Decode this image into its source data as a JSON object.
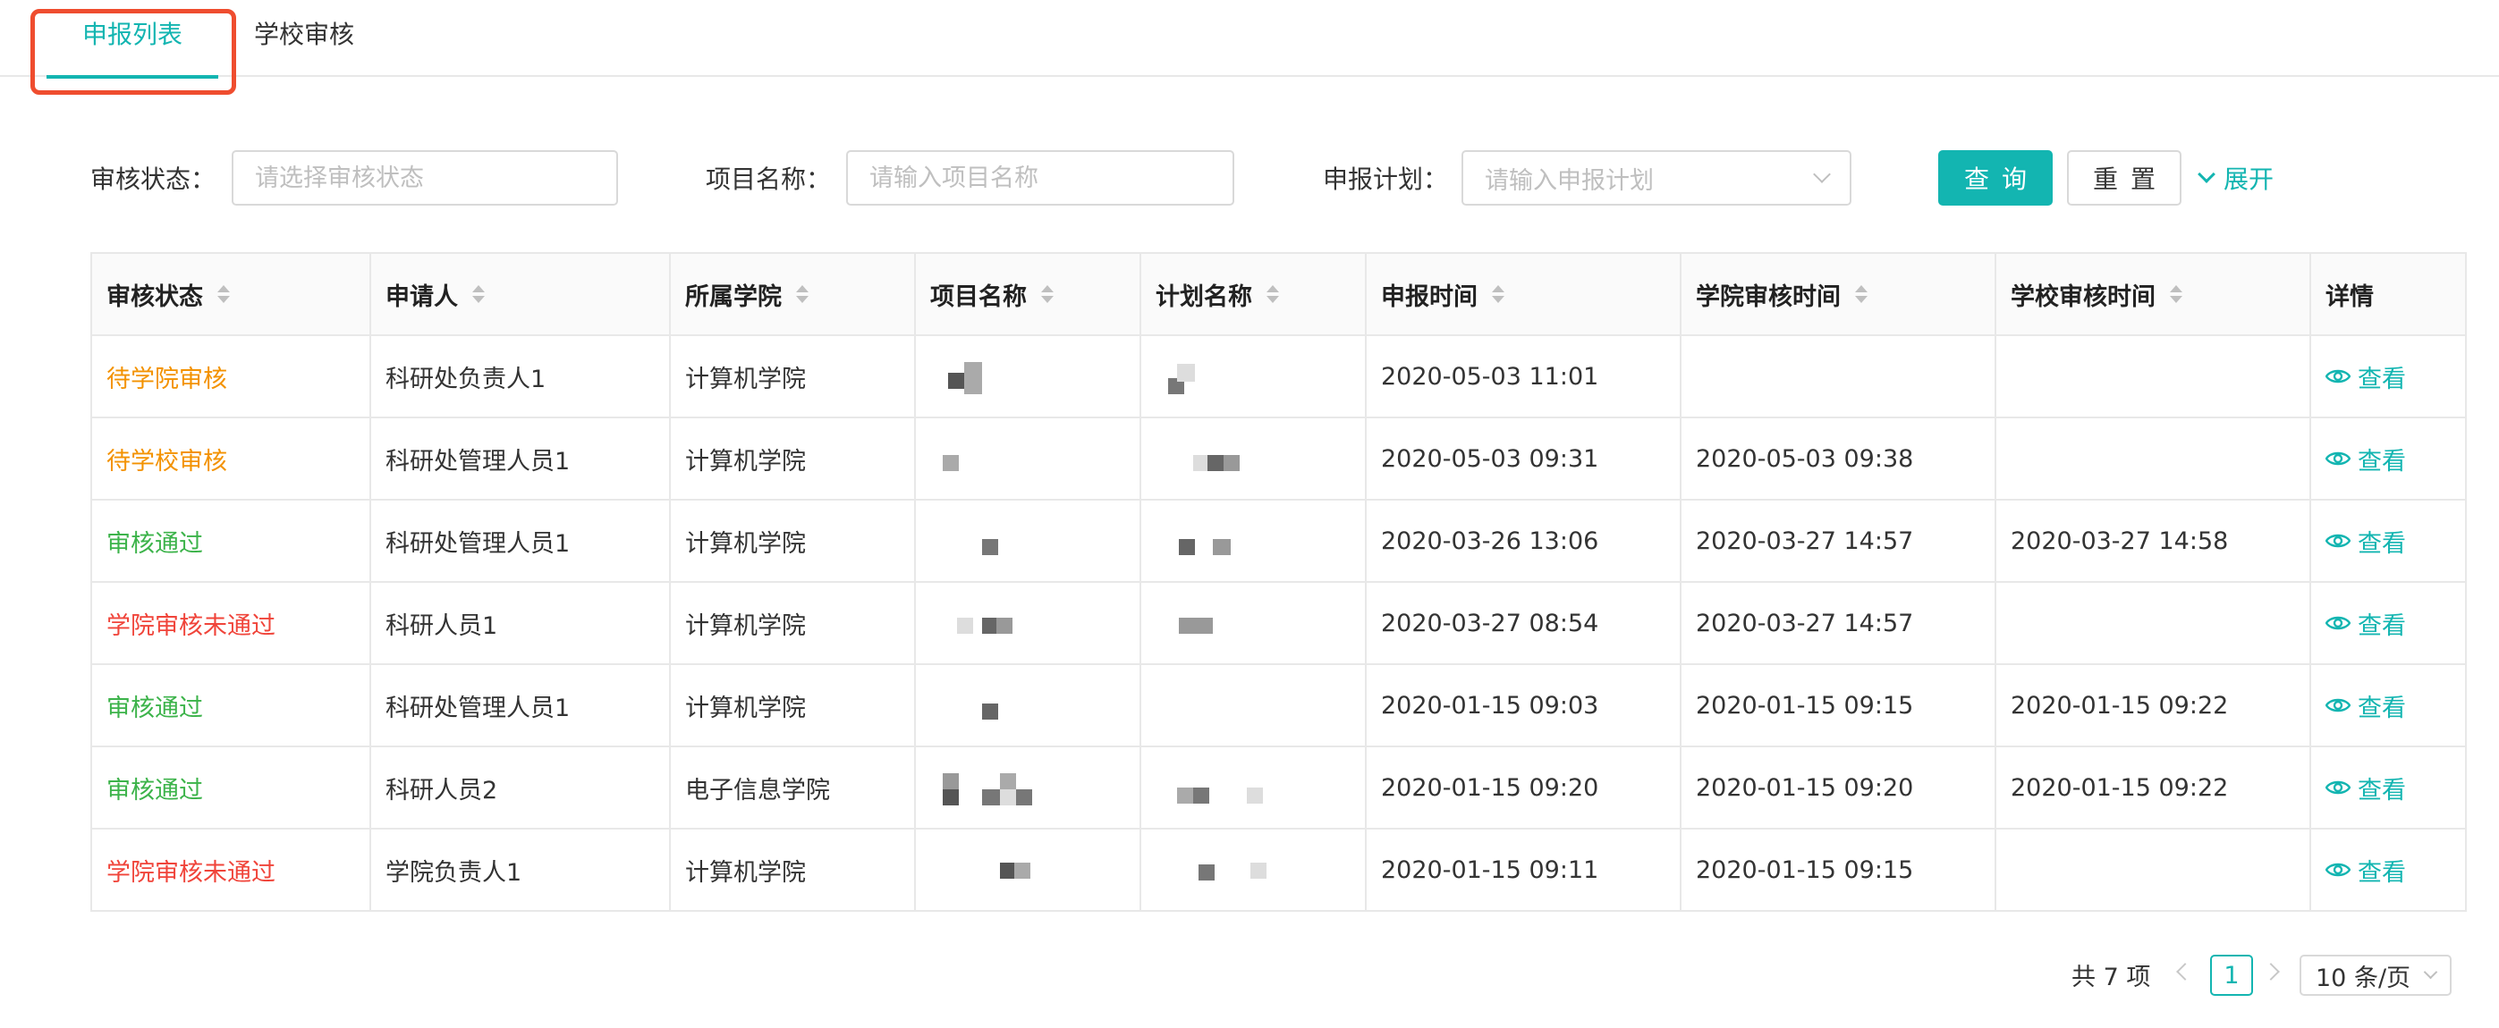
{
  "tabs": [
    {
      "label": "申报列表",
      "active": true
    },
    {
      "label": "学校审核",
      "active": false
    }
  ],
  "filters": {
    "status_label": "审核状态：",
    "status_placeholder": "请选择审核状态",
    "project_label": "项目名称：",
    "project_placeholder": "请输入项目名称",
    "plan_label": "申报计划：",
    "plan_placeholder": "请输入申报计划",
    "query_button": "查询",
    "reset_button": "重置",
    "expand_label": "展开"
  },
  "table": {
    "headers": [
      "审核状态",
      "申请人",
      "所属学院",
      "项目名称",
      "计划名称",
      "申报时间",
      "学院审核时间",
      "学校审核时间",
      "详情"
    ],
    "rows": [
      {
        "status": "待学院审核",
        "status_color": "#f39200",
        "applicant": "科研处负责人1",
        "college": "计算机学院",
        "submit_time": "2020-05-03 11:01",
        "college_review_time": "",
        "school_review_time": "",
        "detail": "查看"
      },
      {
        "status": "待学校审核",
        "status_color": "#f39200",
        "applicant": "科研处管理人员1",
        "college": "计算机学院",
        "submit_time": "2020-05-03 09:31",
        "college_review_time": "2020-05-03 09:38",
        "school_review_time": "",
        "detail": "查看"
      },
      {
        "status": "审核通过",
        "status_color": "#3cb34a",
        "applicant": "科研处管理人员1",
        "college": "计算机学院",
        "submit_time": "2020-03-26 13:06",
        "college_review_time": "2020-03-27 14:57",
        "school_review_time": "2020-03-27 14:58",
        "detail": "查看"
      },
      {
        "status": "学院审核未通过",
        "status_color": "#f0443a",
        "applicant": "科研人员1",
        "college": "计算机学院",
        "submit_time": "2020-03-27 08:54",
        "college_review_time": "2020-03-27 14:57",
        "school_review_time": "",
        "detail": "查看"
      },
      {
        "status": "审核通过",
        "status_color": "#3cb34a",
        "applicant": "科研处管理人员1",
        "college": "计算机学院",
        "submit_time": "2020-01-15 09:03",
        "college_review_time": "2020-01-15 09:15",
        "school_review_time": "2020-01-15 09:22",
        "detail": "查看"
      },
      {
        "status": "审核通过",
        "status_color": "#3cb34a",
        "applicant": "科研人员2",
        "college": "电子信息学院",
        "submit_time": "2020-01-15 09:20",
        "college_review_time": "2020-01-15 09:20",
        "school_review_time": "2020-01-15 09:22",
        "detail": "查看"
      },
      {
        "status": "学院审核未通过",
        "status_color": "#f0443a",
        "applicant": "学院负责人1",
        "college": "计算机学院",
        "submit_time": "2020-01-15 09:11",
        "college_review_time": "2020-01-15 09:15",
        "school_review_time": "",
        "detail": "查看"
      }
    ]
  },
  "pagination": {
    "total": "共 7 项",
    "current_page": "1",
    "page_size": "10 条/页"
  },
  "colors": {
    "accent": "#13b5b1",
    "highlight_border": "#ef4d2f"
  },
  "icons": {
    "detail": "eye-icon",
    "sort": "sort-icon",
    "select": "chevron-down-icon"
  }
}
